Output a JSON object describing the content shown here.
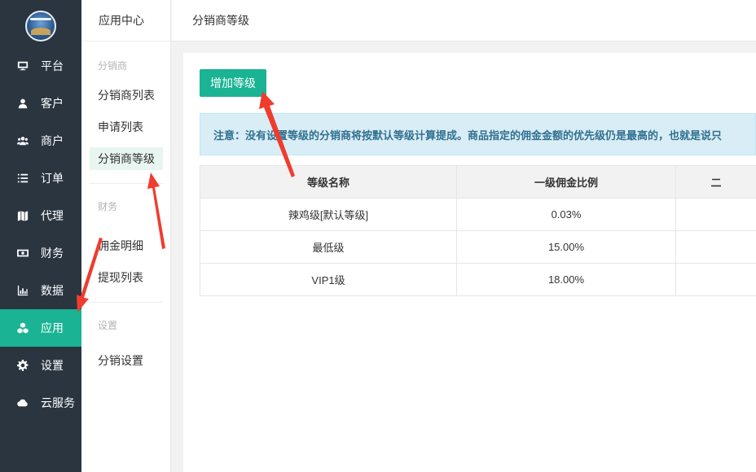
{
  "sidebar": {
    "logo_icon": "logo-icon",
    "items": [
      {
        "label": "平台",
        "icon": "monitor-icon"
      },
      {
        "label": "客户",
        "icon": "user-icon"
      },
      {
        "label": "商户",
        "icon": "users-icon"
      },
      {
        "label": "订单",
        "icon": "list-icon"
      },
      {
        "label": "代理",
        "icon": "map-icon"
      },
      {
        "label": "财务",
        "icon": "money-icon"
      },
      {
        "label": "数据",
        "icon": "bar-chart-icon"
      },
      {
        "label": "应用",
        "icon": "cubes-icon",
        "active": true
      },
      {
        "label": "设置",
        "icon": "gear-icon"
      },
      {
        "label": "云服务",
        "icon": "cloud-icon"
      }
    ]
  },
  "subnav": {
    "title": "应用中心",
    "groups": [
      {
        "title": "分销商",
        "links": [
          "分销商列表",
          "申请列表",
          "分销商等级"
        ]
      },
      {
        "title": "财务",
        "links": [
          "佣金明细",
          "提现列表"
        ]
      },
      {
        "title": "设置",
        "links": [
          "分销设置"
        ]
      }
    ],
    "active_link": "分销商等级"
  },
  "header": {
    "title": "分销商等级"
  },
  "main": {
    "add_button_label": "增加等级",
    "notice_text": "注意：没有设置等级的分销商将按默认等级计算提成。商品指定的佣金金额的优先级仍是最高的，也就是说只",
    "table": {
      "headers": [
        "等级名称",
        "一级佣金比例",
        "二"
      ],
      "rows": [
        [
          "辣鸡级[默认等级]",
          "0.03%",
          ""
        ],
        [
          "最低级",
          "15.00%",
          ""
        ],
        [
          "VIP1级",
          "18.00%",
          ""
        ]
      ]
    }
  },
  "colors": {
    "accent": "#1ab394",
    "sidebar_bg": "#2a3540",
    "annotation": "#f03c2d"
  }
}
